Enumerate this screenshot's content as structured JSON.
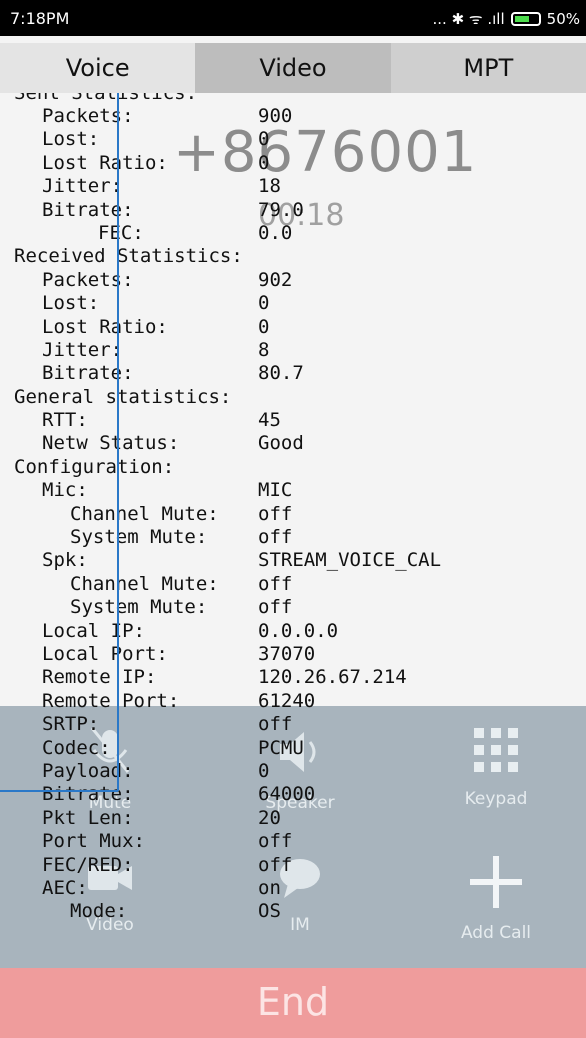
{
  "status_bar": {
    "time": "7:18PM",
    "indicators": "... ✱ ᯤ .ıll",
    "battery": "50%"
  },
  "tabs": [
    {
      "label": "Voice"
    },
    {
      "label": "Video"
    },
    {
      "label": "MPT"
    }
  ],
  "call": {
    "number": "+8676001",
    "timer": "00:18"
  },
  "controls": {
    "mute_label": "Mute",
    "speaker_label": "Speaker",
    "keypad_label": "Keypad",
    "video_label": "Video",
    "im_label": "IM",
    "add_call_label": "Add Call",
    "end_label": "End"
  },
  "stats": {
    "sent_header": "Sent Statistics:",
    "sent": [
      {
        "k": "Packets:",
        "v": "900"
      },
      {
        "k": "Lost:",
        "v": "0"
      },
      {
        "k": "Lost Ratio:",
        "v": "0"
      },
      {
        "k": "Jitter:",
        "v": "18"
      },
      {
        "k": "Bitrate:",
        "v": "79.0"
      },
      {
        "k": "FEC:",
        "v": "0.0"
      }
    ],
    "received_header": "Received Statistics:",
    "received": [
      {
        "k": "Packets:",
        "v": "902"
      },
      {
        "k": "Lost:",
        "v": "0"
      },
      {
        "k": "Lost Ratio:",
        "v": "0"
      },
      {
        "k": "Jitter:",
        "v": "8"
      },
      {
        "k": "Bitrate:",
        "v": "80.7"
      }
    ],
    "general_header": "General statistics:",
    "general": [
      {
        "k": "RTT:",
        "v": "45"
      },
      {
        "k": "Netw Status:",
        "v": "Good"
      }
    ],
    "config_header": "Configuration:",
    "mic": {
      "k": "Mic:",
      "v": "MIC"
    },
    "mic_channel_mute": {
      "k": "Channel Mute:",
      "v": "off"
    },
    "mic_system_mute": {
      "k": "System Mute:",
      "v": "off"
    },
    "spk": {
      "k": "Spk:",
      "v": "STREAM_VOICE_CAL"
    },
    "spk_channel_mute": {
      "k": "Channel Mute:",
      "v": "off"
    },
    "spk_system_mute": {
      "k": "System Mute:",
      "v": "off"
    },
    "config": [
      {
        "k": "Local IP:",
        "v": "0.0.0.0"
      },
      {
        "k": "Local Port:",
        "v": "37070"
      },
      {
        "k": "Remote IP:",
        "v": "120.26.67.214"
      },
      {
        "k": "Remote Port:",
        "v": "61240"
      },
      {
        "k": "SRTP:",
        "v": "off"
      },
      {
        "k": "Codec:",
        "v": "PCMU"
      },
      {
        "k": "Payload:",
        "v": "0"
      },
      {
        "k": "Bitrate:",
        "v": "64000"
      },
      {
        "k": "Pkt Len:",
        "v": "20"
      },
      {
        "k": "Port Mux:",
        "v": "off"
      },
      {
        "k": "FEC/RED:",
        "v": "off"
      },
      {
        "k": "AEC:",
        "v": "on"
      }
    ],
    "aec_mode": {
      "k": "Mode:",
      "v": "OS"
    }
  }
}
